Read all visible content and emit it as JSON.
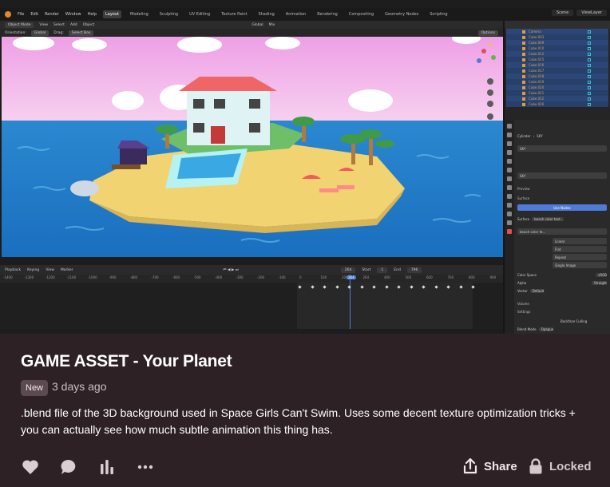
{
  "blender": {
    "menu": [
      "File",
      "Edit",
      "Render",
      "Window",
      "Help"
    ],
    "workspaces": [
      "Layout",
      "Modeling",
      "Sculpting",
      "UV Editing",
      "Texture Paint",
      "Shading",
      "Animation",
      "Rendering",
      "Compositing",
      "Geometry Nodes",
      "Scripting"
    ],
    "active_workspace": "Layout",
    "scene_label": "Scene",
    "view_layer_label": "ViewLayer",
    "toolbar": {
      "mode": "Object Mode",
      "view": "View",
      "select": "Select",
      "add": "Add",
      "object": "Object",
      "transform": "Global",
      "mix": "Mix"
    },
    "toolbar2": {
      "orientation": "Orientation:",
      "global": "Global",
      "drag": "Drag:",
      "select_box": "Select Box",
      "options": "Options"
    },
    "timeline": {
      "playback": "Playback",
      "keying": "Keying",
      "view": "View",
      "marker": "Marker",
      "current_frame": "264",
      "start_label": "Start",
      "start": "1",
      "end_label": "End",
      "end": "796",
      "ruler": [
        "-1400",
        "-1300",
        "-1200",
        "-1100",
        "-1000",
        "-900",
        "-800",
        "-700",
        "-600",
        "-500",
        "-400",
        "-300",
        "-200",
        "-100",
        "0",
        "100",
        "200",
        "264",
        "400",
        "500",
        "600",
        "700",
        "800",
        "900"
      ]
    },
    "outliner_items": [
      "Camera",
      "Cube.003",
      "Cube.009",
      "Cube.010",
      "Cube.012",
      "Cube.015",
      "Cube.016",
      "Cube.017",
      "Cube.018",
      "Cube.019",
      "Cube.020",
      "Cube.021",
      "Cube.022",
      "Cube.026"
    ],
    "properties": {
      "object": "Cylinder",
      "material": "SKY",
      "material_slot": "SKY",
      "material_name": "SKY",
      "preview": "Preview",
      "surface": "Surface",
      "use_nodes": "Use Nodes",
      "surface_label": "Surface",
      "surface_value": "beach color text...",
      "image": "beach color te...",
      "linear": "Linear",
      "flat": "Flat",
      "repeat": "Repeat",
      "single_image": "Single Image",
      "color_space_label": "Color Space",
      "color_space": "sRGB",
      "alpha_label": "Alpha",
      "alpha": "Straight",
      "vector_label": "Vector",
      "vector": "Default",
      "volume": "Volume",
      "settings": "Settings",
      "backface": "Backface Culling",
      "blend_mode_label": "Blend Mode",
      "blend_mode": "Opaque"
    }
  },
  "post": {
    "title": "GAME ASSET - Your Planet",
    "badge": "New",
    "date": "3 days ago",
    "description": ".blend file of the 3D background used in Space Girls Can't Swim. Uses some decent texture optimization tricks + you can actually see how much subtle animation this thing has.",
    "share_label": "Share",
    "locked_label": "Locked"
  },
  "colors": {
    "background": "#2e2126",
    "accent_blue": "#4f7bd8",
    "sky": "#f2b8e8",
    "sea": "#1f76c4",
    "sand": "#f0d070",
    "roof": "#ee5a5a"
  }
}
